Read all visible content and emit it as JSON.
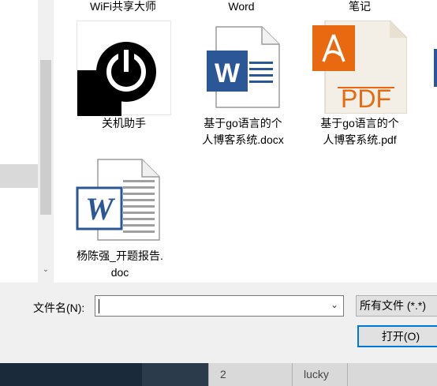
{
  "top_labels": [
    "WiFi共享大师",
    "Word",
    "笔记"
  ],
  "files": [
    {
      "name_line1": "关机助手",
      "name_line2": "",
      "icon": "power-app-icon"
    },
    {
      "name_line1": "基于go语言的个",
      "name_line2": "人博客系统.docx",
      "icon": "word-doc-icon"
    },
    {
      "name_line1": "基于go语言的个",
      "name_line2": "人博客系统.pdf",
      "icon": "pdf-doc-icon"
    },
    {
      "name_line1": "杨陈强_开题报告.",
      "name_line2": "doc",
      "icon": "word-legacy-doc-icon"
    }
  ],
  "pdf_text": "PDF",
  "word_letter": "W",
  "filename": {
    "label": "文件名(N):",
    "value": ""
  },
  "filter": {
    "selected": "所有文件 (*.*)"
  },
  "open_button": "打开(O)",
  "scroll": {
    "down_arrow": "⌄"
  },
  "background_table": {
    "cells": [
      "2",
      "lucky"
    ]
  },
  "colors": {
    "word_blue": "#2b5797",
    "pdf_orange": "#e8690f",
    "accent": "#0078d7"
  }
}
